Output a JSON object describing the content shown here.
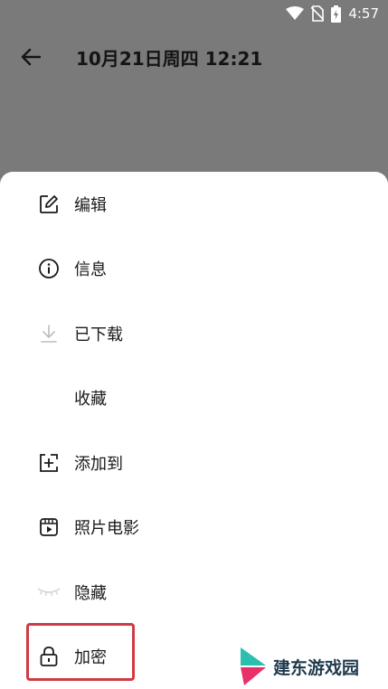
{
  "status_bar": {
    "time": "4:57",
    "icons": [
      "wifi-icon",
      "no-sim-icon",
      "battery-charging-icon"
    ]
  },
  "top_bar": {
    "back_icon": "arrow-left-icon",
    "title": "10月21日周四 12:21"
  },
  "menu": {
    "items": [
      {
        "label": "编辑",
        "icon": "edit-icon"
      },
      {
        "label": "信息",
        "icon": "info-icon"
      },
      {
        "label": "已下载",
        "icon": "download-icon"
      },
      {
        "label": "收藏",
        "icon": ""
      },
      {
        "label": "添加到",
        "icon": "add-to-icon"
      },
      {
        "label": "照片电影",
        "icon": "film-icon"
      },
      {
        "label": "隐藏",
        "icon": "hide-eye-icon"
      },
      {
        "label": "加密",
        "icon": "lock-icon"
      }
    ]
  },
  "watermark": {
    "text": "建东游戏园"
  },
  "colors": {
    "dim_overlay": "#7a7a7a",
    "sheet": "#ffffff",
    "highlight": "#cf3a44",
    "logo_teal": "#2bbfb0",
    "logo_pink": "#e8306b"
  }
}
